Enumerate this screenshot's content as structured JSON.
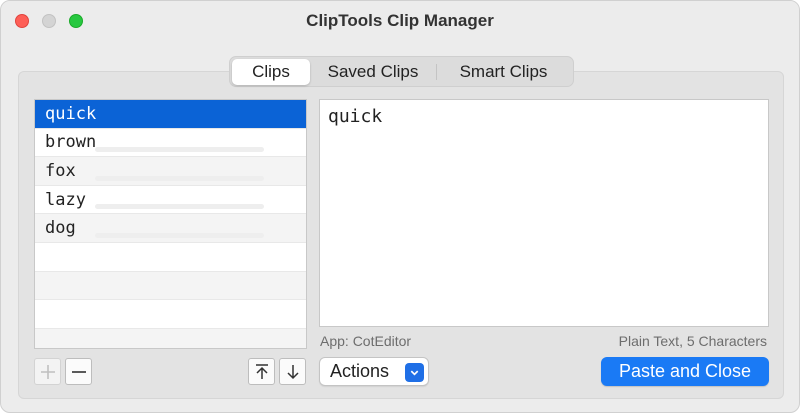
{
  "window": {
    "title": "ClipTools Clip Manager"
  },
  "tabs": [
    {
      "label": "Clips",
      "active": true
    },
    {
      "label": "Saved Clips",
      "active": false
    },
    {
      "label": "Smart Clips",
      "active": false
    }
  ],
  "clips": [
    {
      "text": "quick",
      "selected": true
    },
    {
      "text": "brown",
      "selected": false
    },
    {
      "text": "fox",
      "selected": false
    },
    {
      "text": "lazy",
      "selected": false
    },
    {
      "text": "dog",
      "selected": false
    },
    {
      "text": "",
      "selected": false
    },
    {
      "text": "",
      "selected": false
    },
    {
      "text": "",
      "selected": false
    },
    {
      "text": "",
      "selected": false
    }
  ],
  "preview": {
    "text": "quick",
    "app_label": "App: CotEditor",
    "info_label": "Plain Text, 5 Characters"
  },
  "buttons": {
    "add_icon": "plus-icon",
    "remove_icon": "minus-icon",
    "move_top_icon": "arrow-to-top-icon",
    "move_down_icon": "arrow-down-icon",
    "actions_label": "Actions",
    "paste_label": "Paste and Close"
  },
  "colors": {
    "selection": "#0b63d6",
    "primary_button": "#1a7af5",
    "close": "#fe5f57",
    "zoom": "#28c840"
  }
}
